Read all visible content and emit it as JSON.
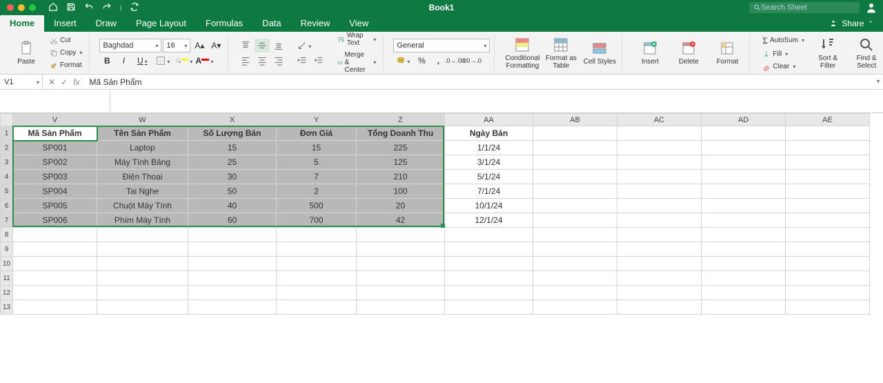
{
  "title": "Book1",
  "search_placeholder": "Search Sheet",
  "tabs": [
    "Home",
    "Insert",
    "Draw",
    "Page Layout",
    "Formulas",
    "Data",
    "Review",
    "View"
  ],
  "active_tab": "Home",
  "share_label": "Share",
  "clipboard": {
    "paste": "Paste",
    "cut": "Cut",
    "copy": "Copy",
    "format": "Format"
  },
  "font": {
    "name": "Baghdad",
    "size": "16",
    "bold": "B",
    "italic": "I",
    "underline": "U",
    "fill_color": "#ffff00",
    "font_color": "#ff0000"
  },
  "align": {
    "wrap": "Wrap Text",
    "merge": "Merge & Center"
  },
  "number": {
    "format": "General"
  },
  "styles": {
    "cond": "Conditional Formatting",
    "astable": "Format as Table",
    "cellstyles": "Cell Styles"
  },
  "cells": {
    "insert": "Insert",
    "delete": "Delete",
    "format": "Format"
  },
  "editing": {
    "autosum": "AutoSum",
    "fill": "Fill",
    "clear": "Clear",
    "sortfilter": "Sort & Filter",
    "findselect": "Find & Select"
  },
  "name_box": "V1",
  "formula_text": "Mã Sản Phẩm",
  "columns": [
    "V",
    "W",
    "X",
    "Y",
    "Z",
    "AA",
    "AB",
    "AC",
    "AD",
    "AE"
  ],
  "selected_cols": [
    "V",
    "W",
    "X",
    "Y",
    "Z"
  ],
  "selected_rows": [
    1,
    2,
    3,
    4,
    5,
    6,
    7
  ],
  "visible_row_count": 13,
  "headers": {
    "v": "Mã Sản Phẩm",
    "w": "Tên Sản Phẩm",
    "x": "Số Lượng Bán",
    "y": "Đơn Giá",
    "z": "Tổng Doanh Thu",
    "aa": "Ngày Bán"
  },
  "rows": [
    {
      "v": "SP001",
      "w": "Laptop",
      "x": "15",
      "y": "15",
      "z": "225",
      "aa": "1/1/24"
    },
    {
      "v": "SP002",
      "w": "Máy Tính Bảng",
      "x": "25",
      "y": "5",
      "z": "125",
      "aa": "3/1/24"
    },
    {
      "v": "SP003",
      "w": "Điện Thoại",
      "x": "30",
      "y": "7",
      "z": "210",
      "aa": "5/1/24"
    },
    {
      "v": "SP004",
      "w": "Tai Nghe",
      "x": "50",
      "y": "2",
      "z": "100",
      "aa": "7/1/24"
    },
    {
      "v": "SP005",
      "w": "Chuột Máy Tính",
      "x": "40",
      "y": "500",
      "z": "20",
      "aa": "10/1/24"
    },
    {
      "v": "SP006",
      "w": "Phím Máy Tính",
      "x": "60",
      "y": "700",
      "z": "42",
      "aa": "12/1/24"
    }
  ],
  "chart_data": {
    "type": "table",
    "title": "Book1",
    "columns": [
      "Mã Sản Phẩm",
      "Tên Sản Phẩm",
      "Số Lượng Bán",
      "Đơn Giá",
      "Tổng Doanh Thu",
      "Ngày Bán"
    ],
    "records": [
      [
        "SP001",
        "Laptop",
        15,
        15,
        225,
        "1/1/24"
      ],
      [
        "SP002",
        "Máy Tính Bảng",
        25,
        5,
        125,
        "3/1/24"
      ],
      [
        "SP003",
        "Điện Thoại",
        30,
        7,
        210,
        "5/1/24"
      ],
      [
        "SP004",
        "Tai Nghe",
        50,
        2,
        100,
        "7/1/24"
      ],
      [
        "SP005",
        "Chuột Máy Tính",
        40,
        500,
        20,
        "10/1/24"
      ],
      [
        "SP006",
        "Phím Máy Tính",
        60,
        700,
        42,
        "12/1/24"
      ]
    ]
  }
}
